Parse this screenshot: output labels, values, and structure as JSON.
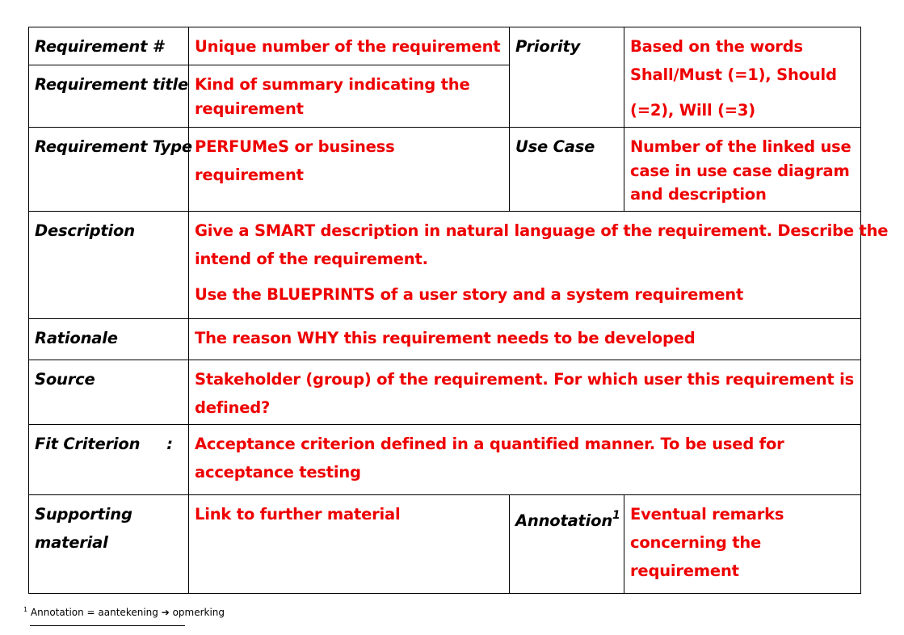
{
  "table": {
    "requirement_number": {
      "label": "Requirement #",
      "value": "Unique number of the requirement"
    },
    "requirement_title": {
      "label": "Requirement title",
      "value_lines": [
        "Kind of summary indicating the",
        "requirement"
      ]
    },
    "priority": {
      "label": "Priority",
      "value_lines": [
        "Based on the words",
        "Shall/Must (=1), Should",
        "(=2), Will (=3)"
      ]
    },
    "requirement_type": {
      "label": "Requirement Type",
      "value_lines": [
        "PERFUMeS or business",
        "requirement"
      ]
    },
    "use_case": {
      "label": "Use Case",
      "value_lines": [
        "Number of the linked use",
        "case in use case diagram",
        "and description"
      ]
    },
    "description": {
      "label": "Description",
      "value_lines": [
        "Give a SMART description in natural language of the requirement. Describe the",
        "intend of the requirement.",
        "Use the BLUEPRINTS of a user story and a system requirement"
      ]
    },
    "rationale": {
      "label": "Rationale",
      "value": "The reason WHY this requirement needs to be developed"
    },
    "source": {
      "label": "Source",
      "value_lines": [
        "Stakeholder (group) of the requirement. For which user this requirement is",
        "defined?"
      ]
    },
    "fit_criterion": {
      "label": "Fit Criterion     :",
      "value_lines": [
        "Acceptance criterion defined in a quantified manner. To be used for",
        "acceptance testing"
      ]
    },
    "supporting_material": {
      "label_lines": [
        "Supporting",
        "material"
      ],
      "value": "Link to further material"
    },
    "annotation": {
      "label": "Annotation",
      "label_sup": "1",
      "value_lines": [
        "Eventual remarks",
        "concerning the",
        "requirement"
      ]
    }
  },
  "footnote": {
    "marker": "1",
    "text": "Annotation = aantekening ➔ opmerking"
  },
  "colors": {
    "value_text": "#ee0000",
    "label_text": "#000000",
    "border": "#000000"
  }
}
